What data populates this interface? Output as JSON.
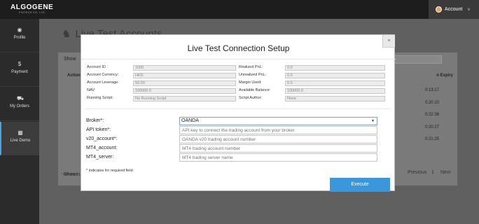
{
  "topbar": {
    "logo": "ALGOGENE",
    "logo_sub": "FINTECH CO. LTD.",
    "account_label": "Account",
    "account_caret": "∨"
  },
  "sidebar": {
    "items": [
      {
        "label": "Profile",
        "icon": "user-icon",
        "glyph": "◉"
      },
      {
        "label": "Payment",
        "icon": "dollar-icon",
        "glyph": "$"
      },
      {
        "label": "My Orders",
        "icon": "cart-icon",
        "glyph": "⛟"
      },
      {
        "label": "Live Demo",
        "icon": "chart-icon",
        "glyph": "▦"
      }
    ]
  },
  "background": {
    "title": "Live Test Accounts",
    "show_label": "Show",
    "actions_header": "Action",
    "expiry_header": "n Expiry",
    "times": [
      "0:13:17",
      "0:20:10",
      "0:22:36",
      "0:20:27",
      "0:21:25"
    ],
    "showing_label": "Showin",
    "pagination": {
      "previous": "Previous",
      "page": "1",
      "next": "Next"
    },
    "footnote": "* timestam"
  },
  "modal": {
    "title": "Live Test Connection Setup",
    "close_label": "×",
    "info_left": [
      {
        "label": "Account ID :",
        "value": "1000"
      },
      {
        "label": "Account Currency:",
        "value": "HKD"
      },
      {
        "label": "Account Leverage:",
        "value": "50.00"
      },
      {
        "label": "NAV:",
        "value": "100000.0"
      },
      {
        "label": "Running Script:",
        "value": "No Running Script"
      }
    ],
    "info_right": [
      {
        "label": "Realized PnL:",
        "value": "0.0"
      },
      {
        "label": "Unrealized PnL:",
        "value": "0.0"
      },
      {
        "label": "Margin Used:",
        "value": "0.0"
      },
      {
        "label": "Available Balance:",
        "value": "100000.0"
      },
      {
        "label": "Script Author:",
        "value": "None"
      }
    ],
    "form": {
      "broker_label": "Broker*:",
      "broker_value": "OANDA",
      "api_token_label": "API token*:",
      "api_token_placeholder": "API key to connect the trading account from your broker",
      "v20_label": "v20_account*:",
      "v20_placeholder": "OANDA v20 trading account number",
      "mt4_account_label": "MT4_account:",
      "mt4_account_placeholder": "MT4 trading account number",
      "mt4_server_label": "MT4_server:",
      "mt4_server_placeholder": "MT4 trading server name"
    },
    "required_note": "* indicates for required field",
    "execute_label": "Execute"
  }
}
